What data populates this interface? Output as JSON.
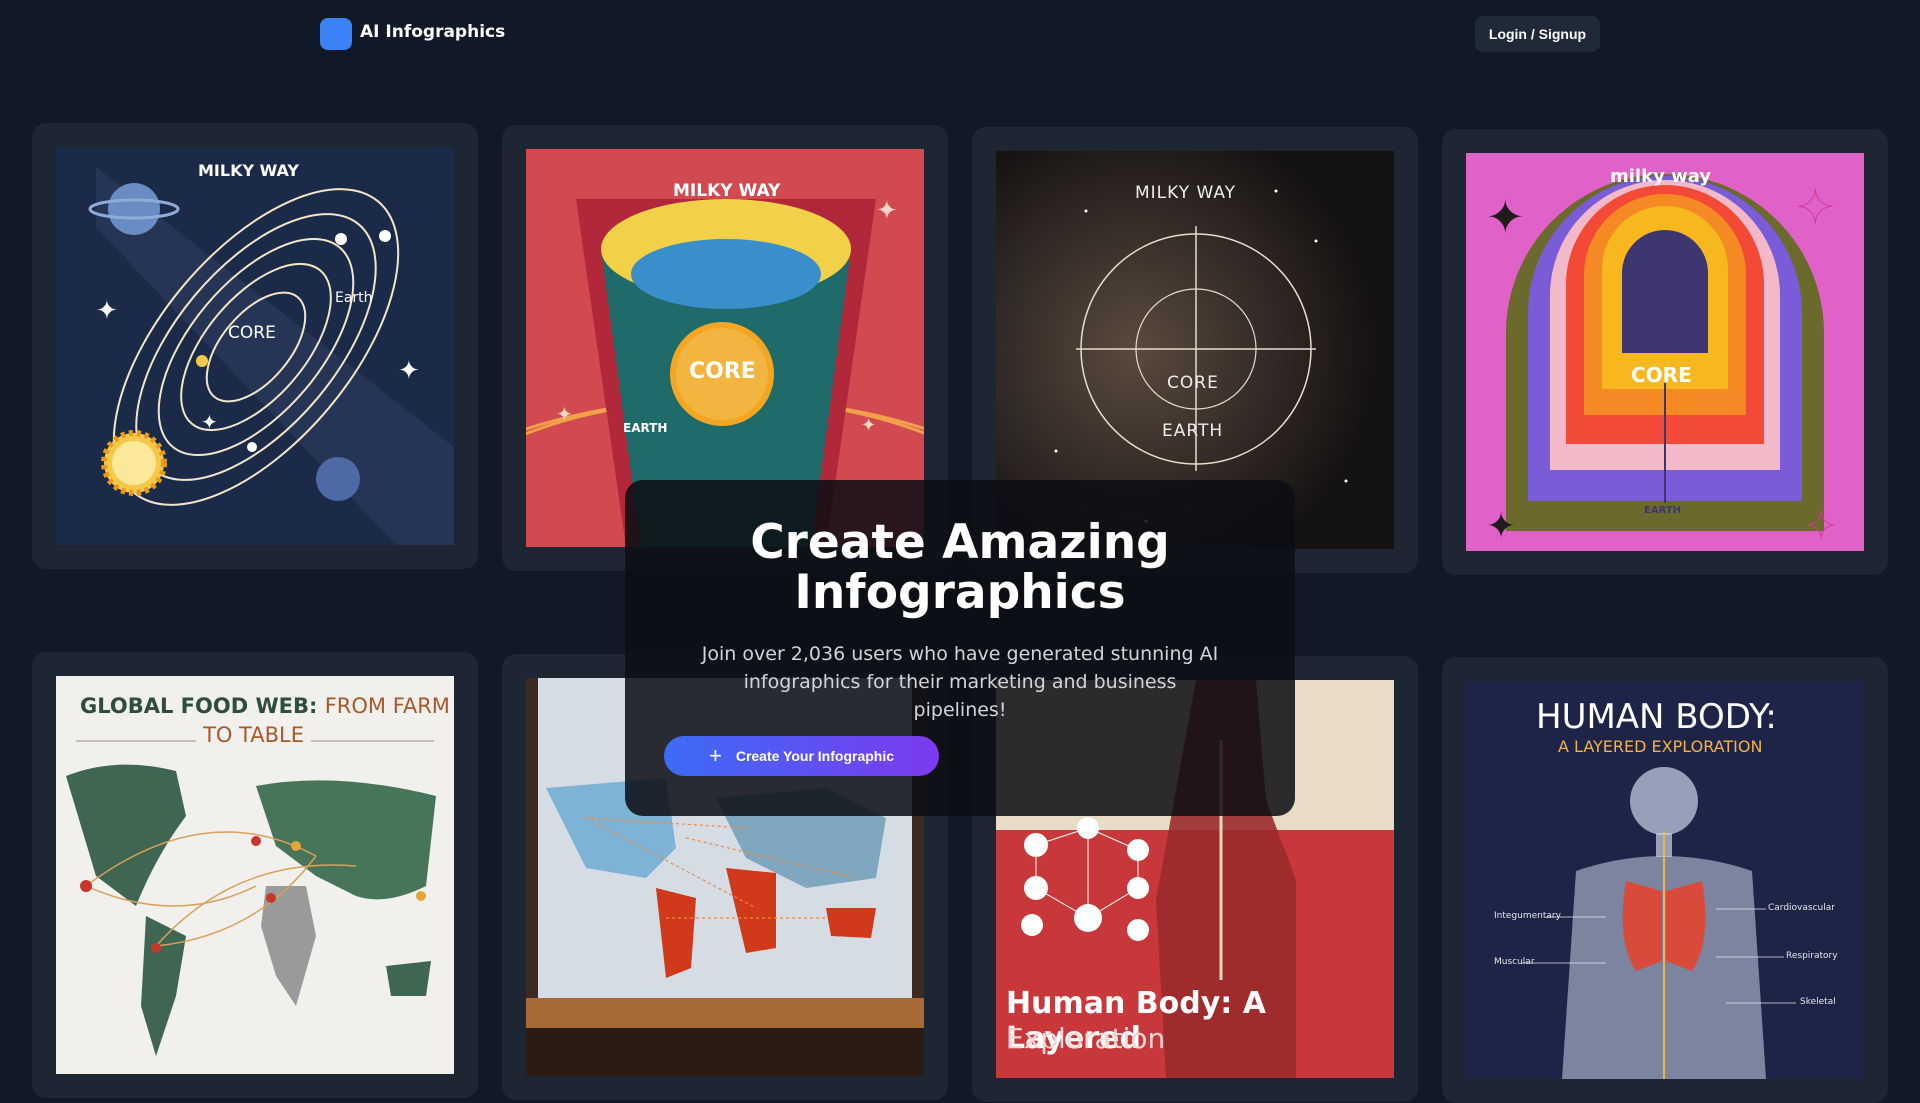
{
  "nav": {
    "brand": "AI Infographics",
    "login_label": "Login / Signup"
  },
  "hero": {
    "title_line1": "Create Amazing",
    "title_line2": "Infographics",
    "subtitle": "Join over 2,036 users who have generated stunning AI infographics for their marketing and business pipelines!",
    "cta_label": "Create Your Infographic",
    "cta_icon": "plus-icon"
  },
  "gallery": {
    "card1": {
      "title": "MILKY WAY",
      "core": "CORE",
      "earth": "Earth"
    },
    "card2": {
      "title": "MILKY WAY",
      "core": "CORE",
      "earth": "EARTH"
    },
    "card3": {
      "title": "MILKY WAY",
      "core": "CORE",
      "earth": "EARTH"
    },
    "card4": {
      "title": "milky way",
      "core": "CORE",
      "earth": "EARTH"
    },
    "card5": {
      "title_a": "GLOBAL FOOD WEB:",
      "title_b": "FROM FARM",
      "title_c": "TO TABLE"
    },
    "card7": {
      "title_a": "Human Body: A Layered",
      "title_b": "Exploration"
    },
    "card8": {
      "title": "HUMAN BODY:",
      "subtitle": "A LAYERED EXPLORATION",
      "labels": [
        "Integumentary",
        "Muscular",
        "Cardiovascular",
        "Respiratory",
        "Skeletal"
      ]
    }
  },
  "colors": {
    "background": "#111827",
    "accent": "#3b82f6",
    "cta_start": "#3b6cf6",
    "cta_end": "#7c3aed"
  }
}
